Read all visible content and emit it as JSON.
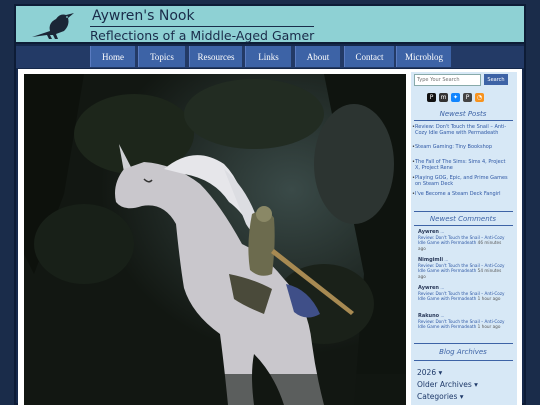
{
  "site": {
    "title": "Aywren's Nook",
    "tagline": "Reflections of a Middle-Aged Gamer"
  },
  "nav": [
    {
      "label": "Home"
    },
    {
      "label": "Topics"
    },
    {
      "label": "Resources"
    },
    {
      "label": "Links"
    },
    {
      "label": "About"
    },
    {
      "label": "Contact"
    },
    {
      "label": "Microblog"
    }
  ],
  "search": {
    "placeholder": "Type Your Search",
    "button_label": "Search"
  },
  "social": [
    {
      "icon": "patreon-icon",
      "color": "#111111",
      "glyph": "P"
    },
    {
      "icon": "mastodon-icon",
      "color": "#333333",
      "glyph": "m"
    },
    {
      "icon": "bluesky-icon",
      "color": "#1185fe",
      "glyph": "✦"
    },
    {
      "icon": "pixelfed-icon",
      "color": "#444444",
      "glyph": "P"
    },
    {
      "icon": "rss-icon",
      "color": "#f7931e",
      "glyph": "◔"
    }
  ],
  "newest_posts": {
    "heading": "Newest Posts",
    "items": [
      "Review: Don't Touch the Snail – Anti-Cozy Idle Game with Permadeath",
      "Steam Gaming: Tiny Bookshop",
      "The Fall of The Sims: Sims 4, Project X, Project Rene",
      "Playing GOG, Epic, and Prime Games on Steam Deck",
      "I've Become a Steam Deck Fangirl"
    ]
  },
  "newest_comments": {
    "heading": "Newest Comments",
    "items": [
      {
        "author": "Aywren",
        "sep": "...",
        "text": "Review: Don't Touch the Snail – Anti-Cozy Idle Game with Permadeath",
        "time": "46 minutes ago"
      },
      {
        "author": "Nimgimli",
        "sep": "...",
        "text": "Review: Don't Touch the Snail – Anti-Cozy Idle Game with Permadeath",
        "time": "54 minutes ago"
      },
      {
        "author": "Aywren",
        "sep": "...",
        "text": "Review: Don't Touch the Snail – Anti-Cozy Idle Game with Permadeath",
        "time": "1 hour ago"
      },
      {
        "author": "Rakuno",
        "sep": "...",
        "text": "Review: Don't Touch the Snail – Anti-Cozy Idle Game with Permadeath",
        "time": "1 hour ago"
      }
    ]
  },
  "archives": {
    "heading": "Blog Archives",
    "items": [
      "2026 ▾",
      "Older Archives ▾",
      "Categories ▾"
    ]
  },
  "colors": {
    "header_bg": "#8ed1d4",
    "nav_button": "#3d63a6",
    "sidebar_bg": "#d7e8f6",
    "link": "#2f58a5"
  }
}
